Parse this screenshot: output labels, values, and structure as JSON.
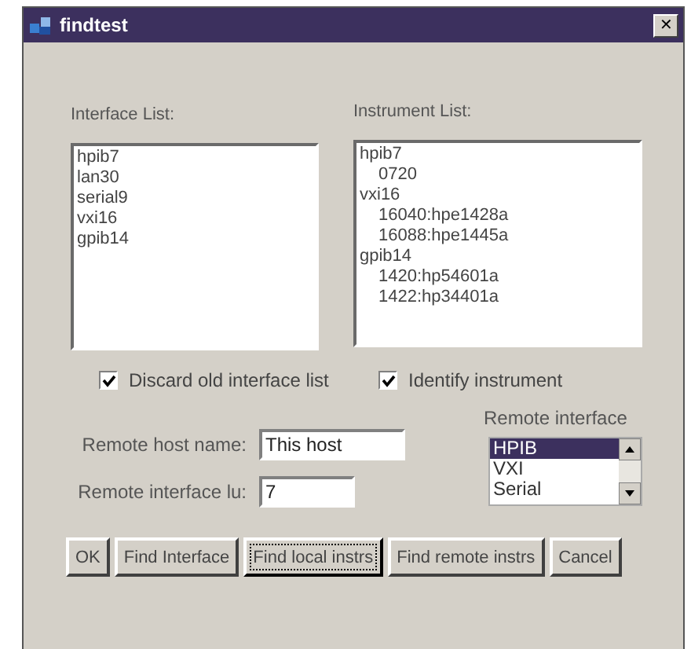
{
  "window": {
    "title": "findtest",
    "close": "✕"
  },
  "interface_list": {
    "label": "Interface List:",
    "items": [
      "hpib7",
      "lan30",
      "serial9",
      "vxi16",
      "gpib14"
    ]
  },
  "instrument_list": {
    "label": "Instrument List:",
    "items": [
      {
        "label": "hpib7",
        "children": [
          {
            "label": "0720"
          }
        ]
      },
      {
        "label": "vxi16",
        "children": [
          {
            "label": "16040:hpe1428a"
          },
          {
            "label": "16088:hpe1445a"
          }
        ]
      },
      {
        "label": "gpib14",
        "children": [
          {
            "label": "1420:hp54601a"
          },
          {
            "label": "1422:hp34401a"
          }
        ]
      }
    ]
  },
  "checkboxes": [
    {
      "label": "Discard old interface list",
      "checked": true
    },
    {
      "label": "Identify instrument",
      "checked": true
    }
  ],
  "remote_host": {
    "label": "Remote host name:",
    "value": "This host"
  },
  "remote_lu": {
    "label": "Remote interface lu:",
    "value": "7"
  },
  "remote_interface": {
    "label": "Remote interface",
    "items": [
      {
        "label": "HPIB",
        "selected": true
      },
      {
        "label": "VXI",
        "selected": false
      },
      {
        "label": "Serial",
        "selected": false
      }
    ]
  },
  "buttons": [
    {
      "label": "OK",
      "focused": false
    },
    {
      "label": "Find Interface",
      "focused": false
    },
    {
      "label": "Find local instrs",
      "focused": true
    },
    {
      "label": "Find remote instrs",
      "focused": false
    },
    {
      "label": "Cancel",
      "focused": false
    }
  ]
}
